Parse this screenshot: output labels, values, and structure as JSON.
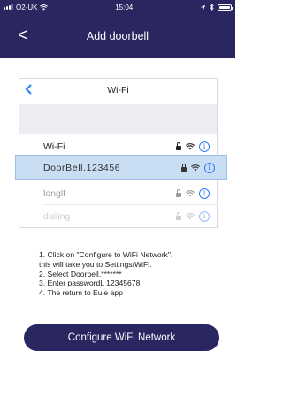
{
  "status_bar": {
    "carrier": "O2-UK",
    "time": "15:04"
  },
  "nav": {
    "back_symbol": "<",
    "title": "Add doorbell"
  },
  "illustration": {
    "back_symbol": "<",
    "title": "Wi-Fi",
    "networks": [
      {
        "name": "Wi-Fi"
      },
      {
        "name": "DoorBell.123456",
        "highlighted": true
      },
      {
        "name": "longlf"
      },
      {
        "name": "dailing"
      }
    ],
    "info_glyph": "i",
    "highlight_color": "#c9ddf3"
  },
  "instructions": [
    "1. Click on \"Configure to WiFi Network\",",
    "this will take you to Settings/WiFi.",
    "2. Select Doorbell.*******",
    "3. Enter passwordL 12345678",
    "4. The return to Eule app"
  ],
  "button": {
    "label": "Configure WiFi Network"
  },
  "colors": {
    "brand": "#2a2660",
    "accent_blue": "#2e7cf6"
  }
}
